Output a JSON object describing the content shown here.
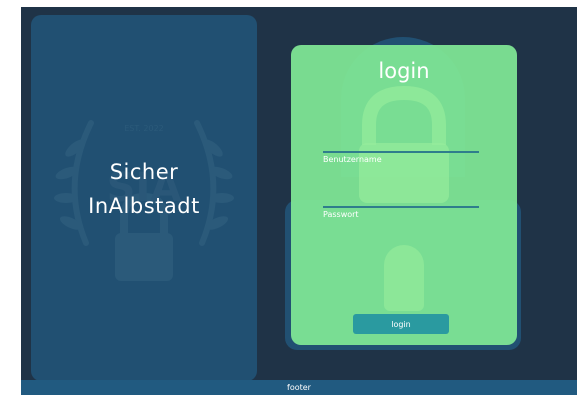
{
  "brand": {
    "line1": "Sicher",
    "line2": "InAlbstadt",
    "emblem_text": "EST. 2022",
    "emblem_letters": "SIA"
  },
  "login": {
    "title": "login",
    "username_label": "Benutzername",
    "username_value": "",
    "password_label": "Passwort",
    "password_value": "",
    "button_label": "login"
  },
  "footer": {
    "text": "footer"
  },
  "icons": {
    "emblem": "laurel-lock-emblem-icon",
    "card_lock": "padlock-icon"
  },
  "colors": {
    "background": "#1f3347",
    "panel": "#215072",
    "card": "#80e896",
    "button": "#2a9aa0",
    "footer": "#215a80"
  }
}
